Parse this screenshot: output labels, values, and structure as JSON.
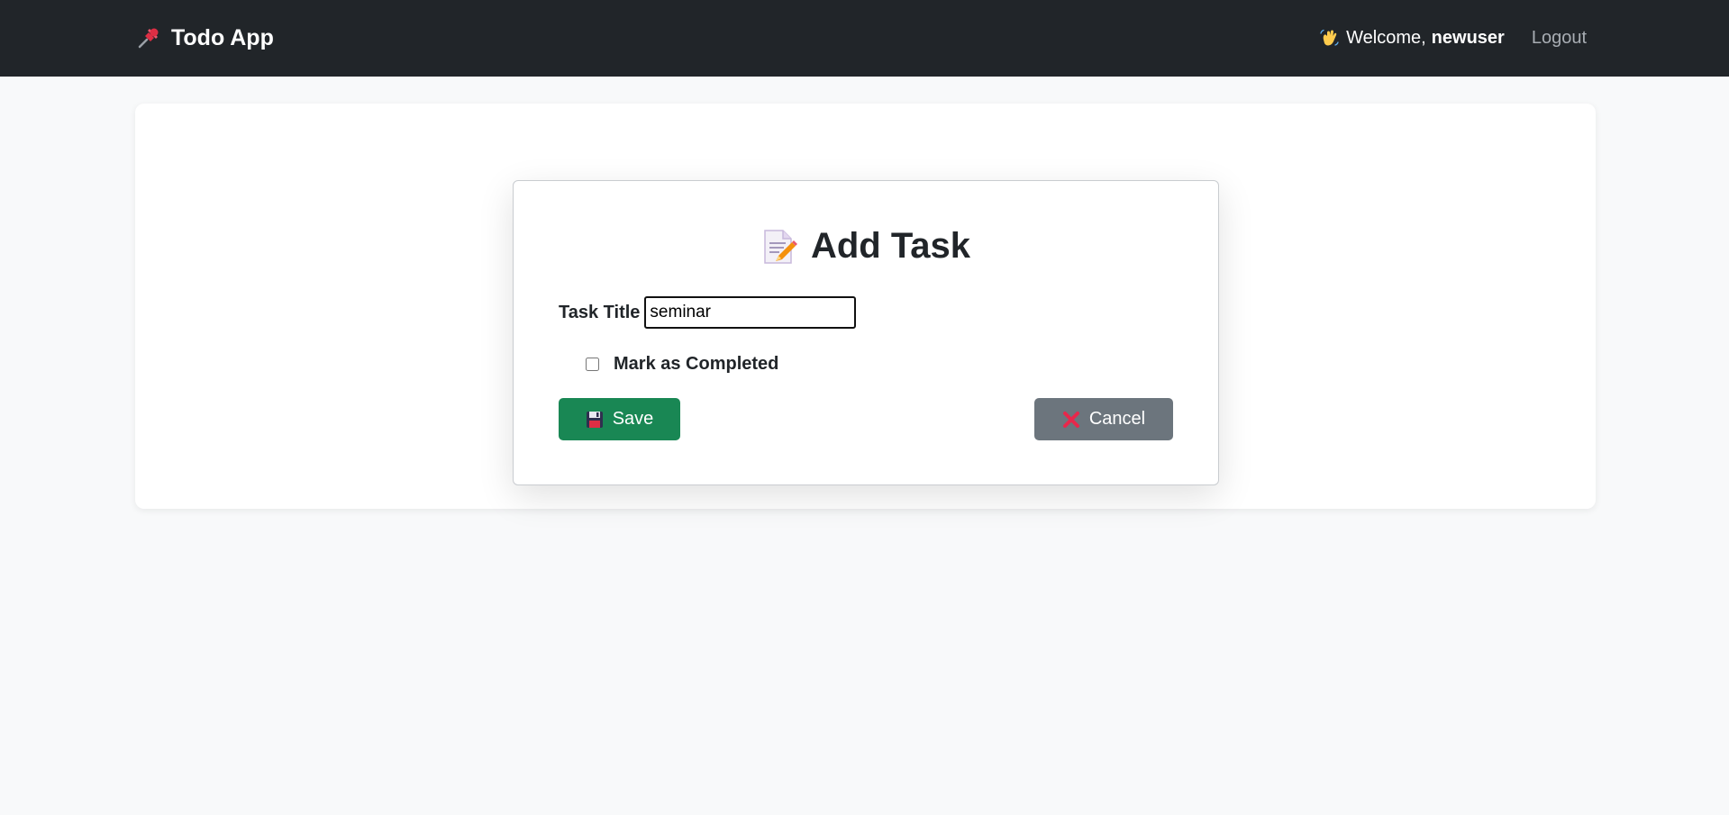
{
  "navbar": {
    "brand_icon": "pushpin-icon",
    "brand_label": "Todo App",
    "welcome_icon": "waving-hand-icon",
    "welcome_prefix": "Welcome,",
    "username": "newuser",
    "logout_label": "Logout"
  },
  "modal": {
    "title_icon": "memo-icon",
    "title": "Add Task",
    "task_title_label": "Task Title",
    "task_title_value": "seminar",
    "completed_label": "Mark as Completed",
    "completed_checked": false,
    "save_icon": "floppy-disk-icon",
    "save_label": "Save",
    "cancel_icon": "cross-mark-icon",
    "cancel_label": "Cancel"
  },
  "colors": {
    "navbar_bg": "#212529",
    "page_bg": "#f8f9fa",
    "save_bg": "#198754",
    "cancel_bg": "#6c757d",
    "logout_text": "#a8adb3"
  }
}
